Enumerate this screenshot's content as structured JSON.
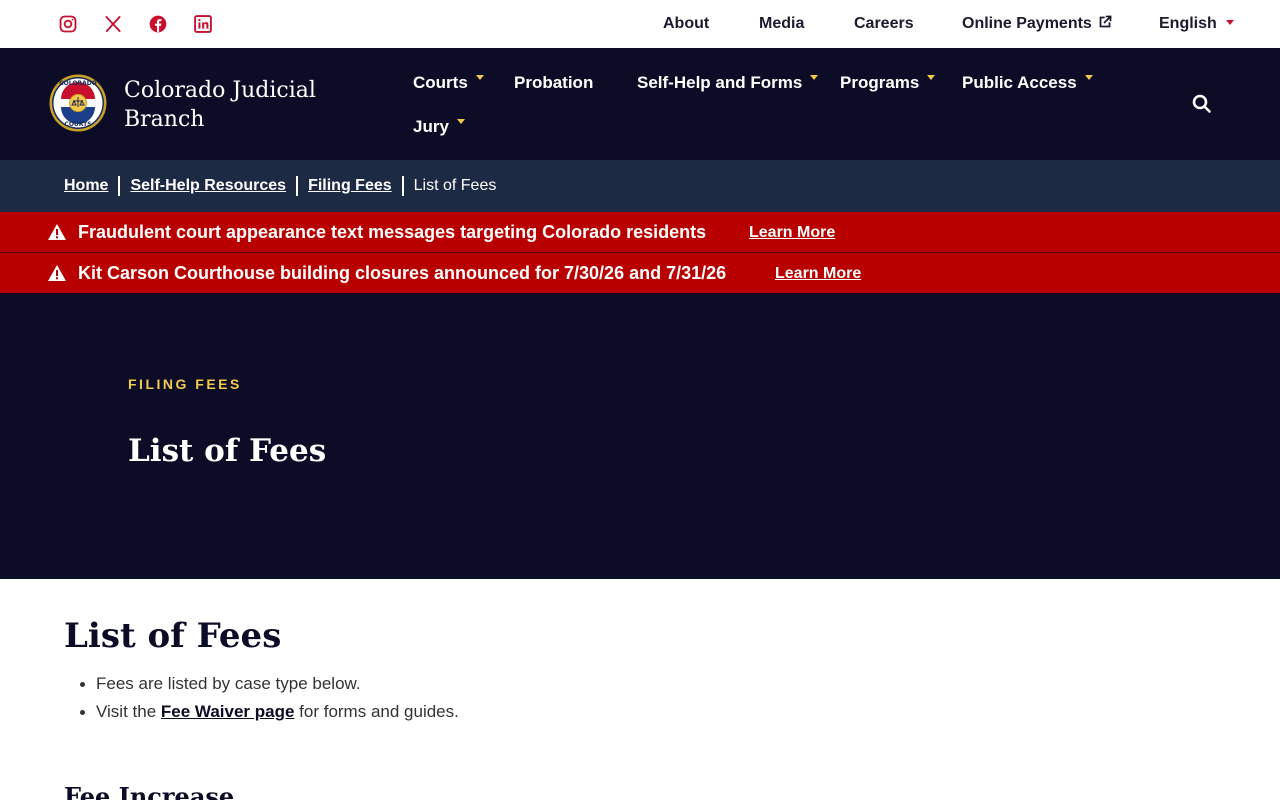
{
  "utility": {
    "social": [
      {
        "name": "instagram-icon"
      },
      {
        "name": "x-icon"
      },
      {
        "name": "facebook-icon"
      },
      {
        "name": "linkedin-icon"
      }
    ],
    "links": {
      "about": "About",
      "media": "Media",
      "careers": "Careers",
      "online_payments": "Online Payments",
      "language": "English"
    },
    "accent_color": "#c8102e"
  },
  "header": {
    "brand_line1": "Colorado Judicial",
    "brand_line2": "Branch",
    "nav": {
      "courts": "Courts",
      "probation": "Probation",
      "self_help": "Self-Help and Forms",
      "programs": "Programs",
      "public_access": "Public Access",
      "jury": "Jury"
    },
    "background": "#0c0c27",
    "caret_color": "#f2c94c"
  },
  "breadcrumb": {
    "home": "Home",
    "self_help_resources": "Self-Help Resources",
    "filing_fees": "Filing Fees",
    "current": "List of Fees"
  },
  "alerts": [
    {
      "message": "Fraudulent court appearance text messages targeting Colorado residents",
      "link": "Learn More"
    },
    {
      "message": "Kit Carson Courthouse building closures announced for 7/30/26 and 7/31/26",
      "link": "Learn More"
    }
  ],
  "alert_color": "#b90000",
  "hero": {
    "eyebrow": "FILING FEES",
    "title": "List of Fees"
  },
  "content": {
    "title": "List of Fees",
    "bullet1": "Fees are listed by case type below.",
    "bullet2_prefix": "Visit the ",
    "bullet2_link": "Fee Waiver page",
    "bullet2_suffix": " for forms and guides.",
    "subhead": "Fee Increase"
  }
}
